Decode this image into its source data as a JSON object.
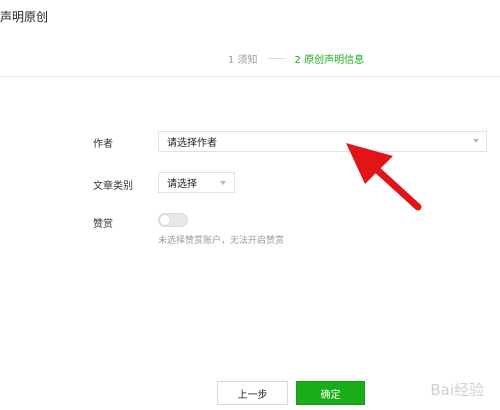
{
  "header": {
    "title": "声明原创"
  },
  "steps": [
    {
      "label": "1 须知"
    },
    {
      "label": "2 原创声明信息",
      "active": true
    }
  ],
  "form": {
    "author": {
      "label": "作者",
      "value": "请选择作者"
    },
    "category": {
      "label": "文章类别",
      "value": "请选择"
    },
    "reward": {
      "label": "赞赏",
      "enabled": false,
      "hint": "未选择赞赏账户，无法开启赞赏"
    }
  },
  "buttons": {
    "prev": "上一步",
    "confirm": "确定"
  },
  "watermark": "Bai经验",
  "colors": {
    "accent": "#1aad19",
    "annotation_arrow": "#e2141a"
  }
}
